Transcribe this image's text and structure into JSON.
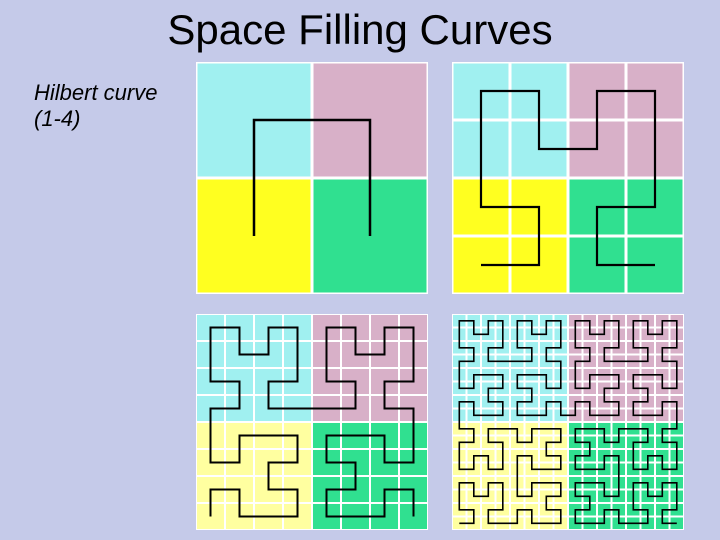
{
  "title": "Space Filling Curves",
  "label_line1": "Hilbert curve",
  "label_line2": "(1-4)",
  "quadrant_colors": {
    "tl": "#a0f0f0",
    "tr": "#d8b0c8",
    "bl": "#ffff20",
    "br": "#30e090",
    "bl_pale": "#ffffa0"
  }
}
